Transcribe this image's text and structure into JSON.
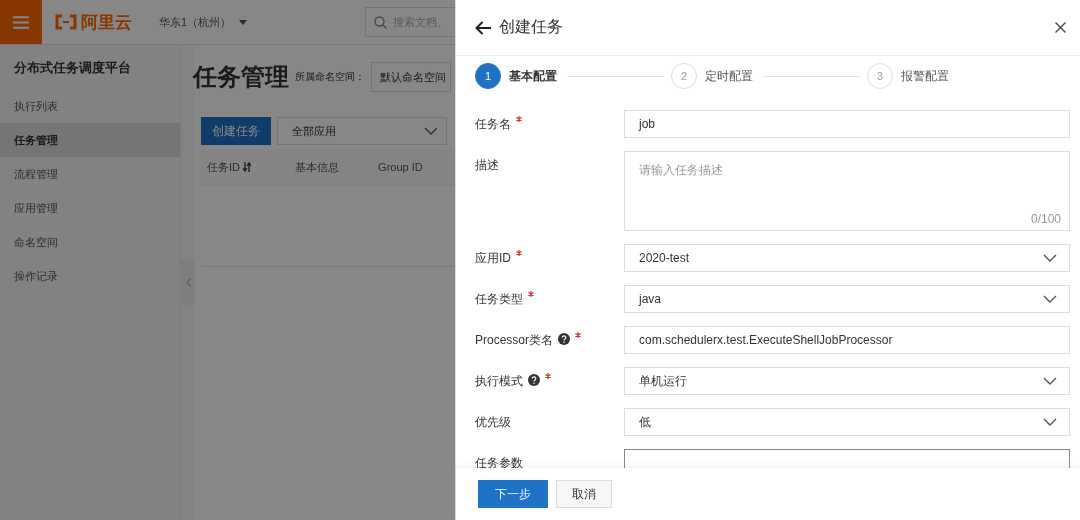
{
  "header": {
    "logo": "阿里云",
    "region": "华东1（杭州）",
    "search_placeholder": "搜索文档、"
  },
  "sidebar": {
    "title": "分布式任务调度平台",
    "items": [
      {
        "label": "执行列表",
        "selected": false
      },
      {
        "label": "任务管理",
        "selected": true
      },
      {
        "label": "流程管理",
        "selected": false
      },
      {
        "label": "应用管理",
        "selected": false
      },
      {
        "label": "命名空间",
        "selected": false
      },
      {
        "label": "操作记录",
        "selected": false
      }
    ]
  },
  "main": {
    "title": "任务管理",
    "namespace_label": "所属命名空间：",
    "namespace_value": "默认命名空间",
    "create_button": "创建任务",
    "app_filter": "全部应用",
    "columns": [
      "任务ID",
      "基本信息",
      "Group ID"
    ]
  },
  "drawer": {
    "title": "创建任务",
    "steps": [
      {
        "number": "1",
        "label": "基本配置",
        "selected": true
      },
      {
        "number": "2",
        "label": "定时配置",
        "selected": false
      },
      {
        "number": "3",
        "label": "报警配置",
        "selected": false
      }
    ],
    "fields": [
      {
        "kind": "input",
        "label": "任务名",
        "required": true,
        "help": false,
        "value": "job"
      },
      {
        "kind": "textarea",
        "label": "描述",
        "required": false,
        "help": false,
        "placeholder": "请输入任务描述",
        "counter": "0/100"
      },
      {
        "kind": "select",
        "label": "应用ID",
        "required": true,
        "help": false,
        "value": "2020-test"
      },
      {
        "kind": "select",
        "label": "任务类型",
        "required": true,
        "help": false,
        "value": "java"
      },
      {
        "kind": "input",
        "label": "Processor类名",
        "required": true,
        "help": true,
        "value": "com.schedulerx.test.ExecuteShellJobProcessor"
      },
      {
        "kind": "select",
        "label": "执行模式",
        "required": true,
        "help": true,
        "value": "单机运行"
      },
      {
        "kind": "select",
        "label": "优先级",
        "required": false,
        "help": false,
        "value": "低"
      },
      {
        "kind": "input",
        "label": "任务参数",
        "required": false,
        "help": false
      }
    ],
    "buttons": [
      {
        "label": "下一步",
        "primary": true
      },
      {
        "label": "取消",
        "primary": false
      }
    ]
  }
}
